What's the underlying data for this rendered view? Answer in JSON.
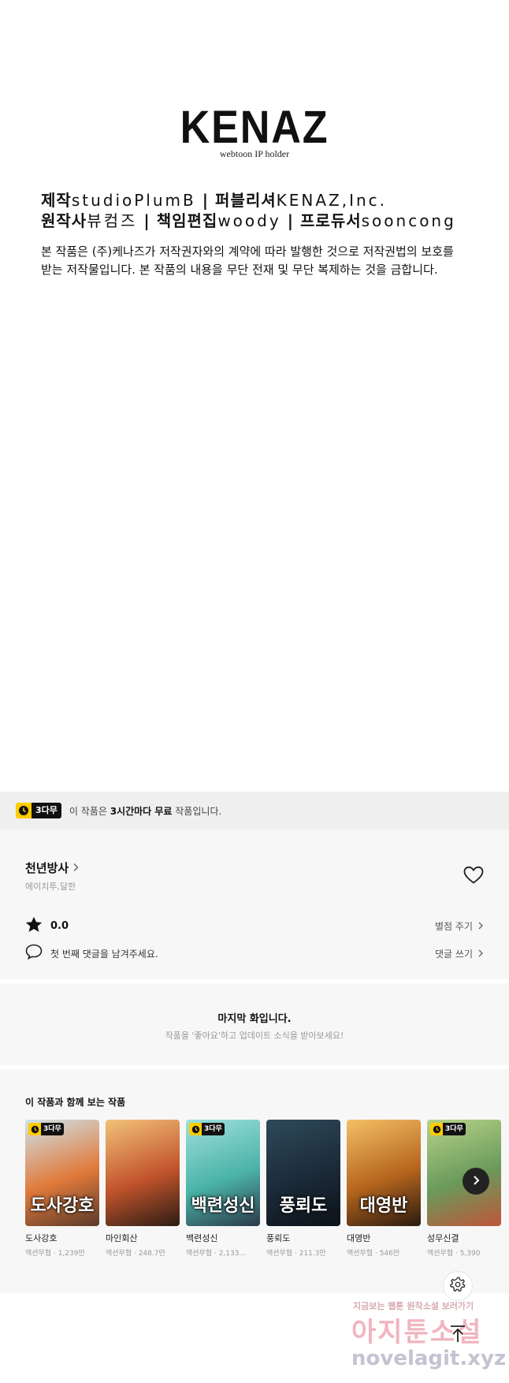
{
  "credits": {
    "logo": "KENAZ",
    "logo_sub": "webtoon IP holder",
    "line1": [
      {
        "label": "제작",
        "value": "studioPlumB"
      },
      {
        "label": "퍼블리셔",
        "value": "KENAZ,Inc."
      }
    ],
    "line2": [
      {
        "label": "원작사",
        "value": "뷰컴즈"
      },
      {
        "label": "책임편집",
        "value": "woody"
      },
      {
        "label": "프로듀서",
        "value": "sooncong"
      }
    ],
    "separator": "|",
    "notice_line1": "본 작품은 (주)케나즈가 저작권자와의 계약에 따라 발행한 것으로 저작권법의 보호를",
    "notice_line2": "받는 저작물입니다. 본 작품의 내용을 무단 전재 및 무단 복제하는 것을 금합니다."
  },
  "banner": {
    "badge": "3다무",
    "text_before": "이 작품은 ",
    "text_bold": "3시간마다 무료",
    "text_after": " 작품입니다."
  },
  "info": {
    "title": "천년방사",
    "author": "에이치투,달한",
    "rating": "0.0",
    "rate_link": "별점 주기",
    "comment_prompt": "첫 번째 댓글을 남겨주세요.",
    "comment_link": "댓글 쓰기"
  },
  "last_episode": {
    "title": "마지막 화입니다.",
    "subtitle": "작품을 '좋아요'하고 업데이트 소식을 받아보세요!"
  },
  "recommendations": {
    "heading": "이 작품과 함께 보는 작품",
    "items": [
      {
        "name": "도사강호",
        "meta": "액션무협 · 1,239만",
        "badge": "3다무",
        "cover_text": "도사강호",
        "colors": [
          "#cfe3ea",
          "#e07a3b",
          "#5a3a2a"
        ]
      },
      {
        "name": "마인회산",
        "meta": "액션무협 · 248.7만",
        "badge": "",
        "cover_text": "",
        "colors": [
          "#f2c27a",
          "#c2542c",
          "#2c1c14"
        ]
      },
      {
        "name": "백련성신",
        "meta": "액션무협 · 2,133...",
        "badge": "3다무",
        "cover_text": "백련성신",
        "colors": [
          "#9fe0dc",
          "#4bb3a8",
          "#2a3a4a"
        ]
      },
      {
        "name": "풍뢰도",
        "meta": "액션무협 · 211.3만",
        "badge": "",
        "cover_text": "풍뢰도",
        "colors": [
          "#2e4a5a",
          "#1b2a38",
          "#0c1218"
        ]
      },
      {
        "name": "대영반",
        "meta": "액션무협 · 546만",
        "badge": "",
        "cover_text": "대영반",
        "colors": [
          "#f4c066",
          "#b5651d",
          "#2a1a10"
        ]
      },
      {
        "name": "성무신결",
        "meta": "액션무협 · 5,390",
        "badge": "3다무",
        "cover_text": "",
        "colors": [
          "#b7d38a",
          "#6a9a5a",
          "#c0553a"
        ]
      }
    ]
  },
  "watermark": {
    "line1": "지금보는 웹툰 원작소설 보러가기",
    "line2": "아지툰소설",
    "line3": "novelagit.xyz"
  }
}
